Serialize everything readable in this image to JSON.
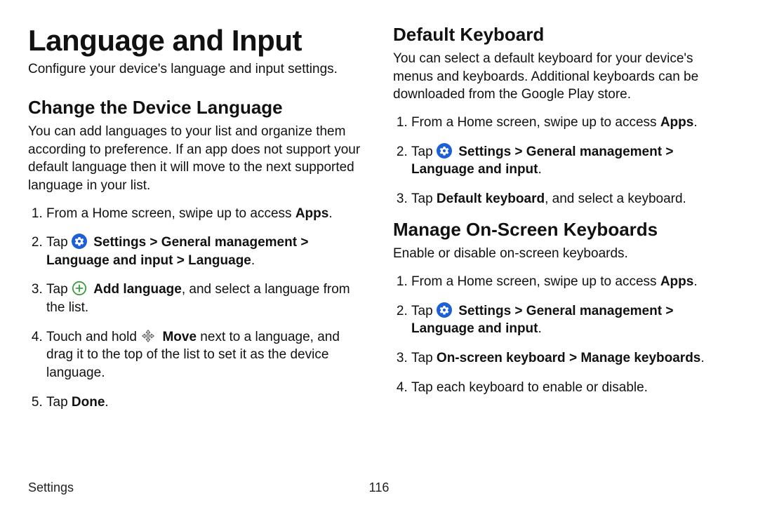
{
  "page": {
    "title": "Language and Input",
    "subtitle": "Configure your device's language and input settings.",
    "footer_section": "Settings",
    "page_number": "116"
  },
  "left": {
    "section_heading": "Change the Device Language",
    "intro": "You can add languages to your list and organize them according to preference. If an app does not support your default language then it will move to the next supported language in your list.",
    "step1_pre": "From a Home screen, swipe up to access ",
    "step1_bold": "Apps",
    "step1_post": ".",
    "step2_pre": "Tap ",
    "step2_bold": "Settings > General management > Language and input > Language",
    "step2_post": ".",
    "step3_pre": "Tap ",
    "step3_bold": "Add language",
    "step3_post": ", and select a language from the list.",
    "step4_pre": "Touch and hold ",
    "step4_bold": "Move",
    "step4_post": " next to a language, and drag it to the top of the list to set it as the device language.",
    "step5_pre": "Tap ",
    "step5_bold": "Done",
    "step5_post": "."
  },
  "right": {
    "sectionA_heading": "Default Keyboard",
    "sectionA_intro": "You can select a default keyboard for your device's menus and keyboards. Additional keyboards can be downloaded from the Google Play store.",
    "a_step1_pre": "From a Home screen, swipe up to access ",
    "a_step1_bold": "Apps",
    "a_step1_post": ".",
    "a_step2_pre": "Tap ",
    "a_step2_bold": "Settings > General management > Language and input",
    "a_step2_post": ".",
    "a_step3_pre": "Tap ",
    "a_step3_bold": "Default keyboard",
    "a_step3_post": ", and select a keyboard.",
    "sectionB_heading": "Manage On-Screen Keyboards",
    "sectionB_intro": "Enable or disable on-screen keyboards.",
    "b_step1_pre": "From a Home screen, swipe up to access ",
    "b_step1_bold": "Apps",
    "b_step1_post": ".",
    "b_step2_pre": "Tap ",
    "b_step2_bold": "Settings > General management > Language and input",
    "b_step2_post": ".",
    "b_step3_pre": "Tap ",
    "b_step3_bold": "On-screen keyboard > Manage keyboards",
    "b_step3_post": ".",
    "b_step4": "Tap each keyboard to enable or disable."
  }
}
